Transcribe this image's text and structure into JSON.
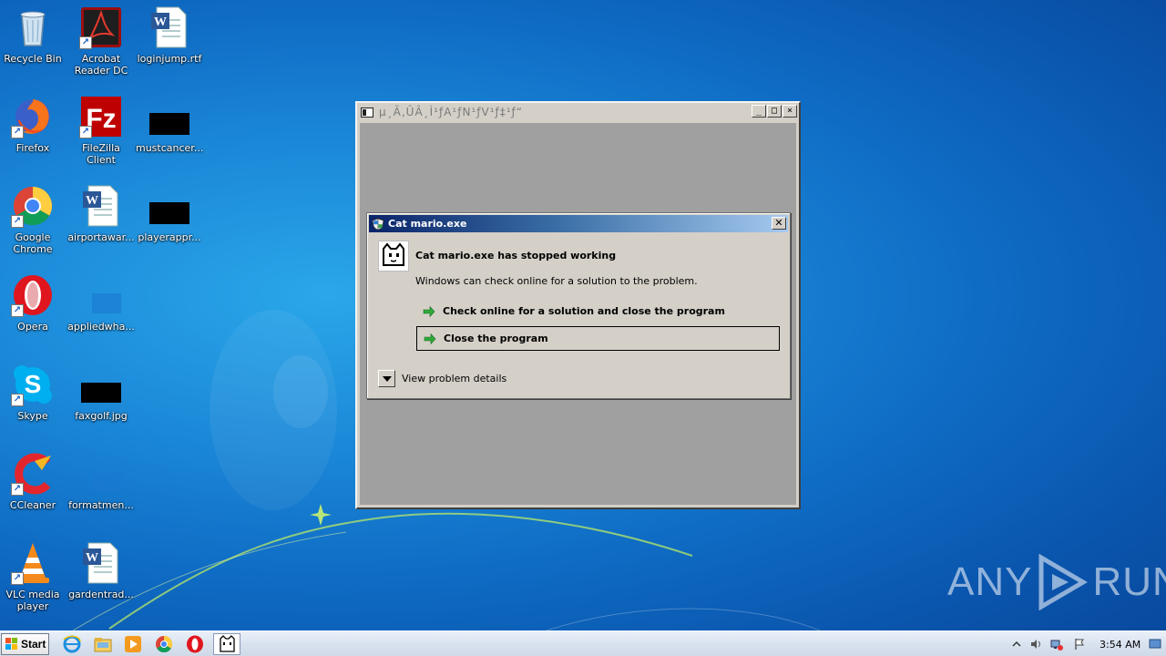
{
  "desktop": {
    "icons": [
      {
        "label": "Recycle Bin"
      },
      {
        "label": "Acrobat Reader DC"
      },
      {
        "label": "loginjump.rtf"
      },
      {
        "label": "Firefox"
      },
      {
        "label": "FileZilla Client"
      },
      {
        "label": "mustcancer..."
      },
      {
        "label": "Google Chrome"
      },
      {
        "label": "airportawar..."
      },
      {
        "label": "playerappr..."
      },
      {
        "label": "Opera"
      },
      {
        "label": "appliedwha..."
      },
      {
        "label": "Skype"
      },
      {
        "label": "faxgolf.jpg"
      },
      {
        "label": "CCleaner"
      },
      {
        "label": "formatmen..."
      },
      {
        "label": "VLC media player"
      },
      {
        "label": "gardentrad..."
      }
    ]
  },
  "game_window": {
    "title": "µ¸Ã‚ÛÂ¸Ì¹ƒA¹ƒN¹ƒV¹ƒ‡¹ƒ“"
  },
  "error_dialog": {
    "title": "Cat mario.exe",
    "heading": "Cat mario.exe has stopped working",
    "message": "Windows can check online for a solution to the problem.",
    "option_check_online": "Check online for a solution and close the program",
    "option_close": "Close the program",
    "details_label": "View problem details",
    "close_glyph": "✕"
  },
  "watermark": {
    "left": "ANY",
    "right": "RUN"
  },
  "taskbar": {
    "start_label": "Start",
    "clock": "3:54 AM"
  }
}
